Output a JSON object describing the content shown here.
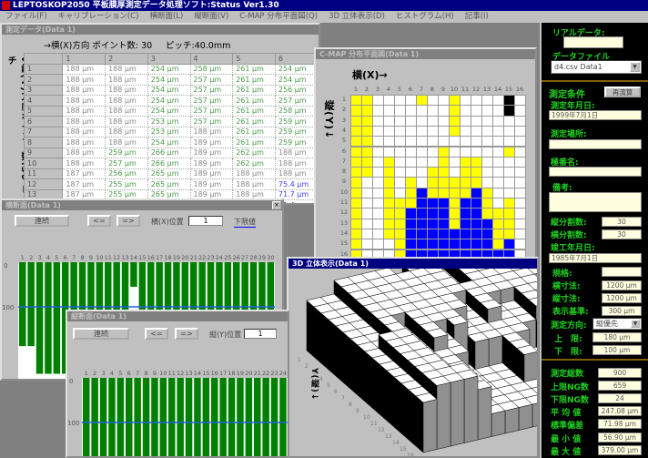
{
  "app": {
    "title": "LEPTOSKOP2050 平板膜厚測定データ処理ソフト:Status Ver1.30"
  },
  "menu": [
    "ファイル(F)",
    "キャリブレーション(C)",
    "横断面(L)",
    "縦断面(V)",
    "C-MAP 分布平面図(Q)",
    "3D 立体表示(D)",
    "ヒストグラム(H)",
    "記事(I)"
  ],
  "table_window": {
    "title": "測定データ(Data 1)",
    "header_text": "→横(X)方向 ポイント数:  30",
    "pitch_text": "ピッチ:40.0mm",
    "side_label": "↓縦(Y)方向ポイント数:30 ピッチ",
    "columns": [
      "1",
      "2",
      "3",
      "4",
      "5",
      "6"
    ],
    "rows": [
      [
        "1",
        "188 μm",
        "188 μm",
        "254 μm",
        "258 μm",
        "261 μm",
        "254 μm"
      ],
      [
        "2",
        "188 μm",
        "188 μm",
        "254 μm",
        "257 μm",
        "261 μm",
        "254 μm"
      ],
      [
        "3",
        "188 μm",
        "188 μm",
        "254 μm",
        "257 μm",
        "261 μm",
        "256 μm"
      ],
      [
        "4",
        "188 μm",
        "188 μm",
        "254 μm",
        "257 μm",
        "261 μm",
        "257 μm"
      ],
      [
        "5",
        "188 μm",
        "188 μm",
        "254 μm",
        "257 μm",
        "261 μm",
        "258 μm"
      ],
      [
        "6",
        "188 μm",
        "188 μm",
        "253 μm",
        "257 μm",
        "261 μm",
        "259 μm"
      ],
      [
        "7",
        "188 μm",
        "188 μm",
        "253 μm",
        "188 μm",
        "261 μm",
        "259 μm"
      ],
      [
        "8",
        "188 μm",
        "188 μm",
        "254 μm",
        "189 μm",
        "261 μm",
        "259 μm"
      ],
      [
        "9",
        "188 μm",
        "259 μm",
        "266 μm",
        "189 μm",
        "262 μm",
        "188 μm"
      ],
      [
        "10",
        "188 μm",
        "257 μm",
        "266 μm",
        "189 μm",
        "262 μm",
        "188 μm"
      ],
      [
        "11",
        "187 μm",
        "256 μm",
        "265 μm",
        "189 μm",
        "188 μm",
        "188 μm"
      ],
      [
        "12",
        "187 μm",
        "255 μm",
        "265 μm",
        "189 μm",
        "188 μm",
        "75.4 μm"
      ],
      [
        "13",
        "187 μm",
        "255 μm",
        "265 μm",
        "189 μm",
        "188 μm",
        "71.7 μm"
      ],
      [
        "14",
        "187 μm",
        "255 μm",
        "265 μm",
        "189 μm",
        "188 μm",
        "71.4 μm"
      ]
    ]
  },
  "cmap_window": {
    "title": "C-MAP 分布平面図(Data 1)",
    "x_label": "横(X)→",
    "y_label": "縦(Y)↓",
    "col_labels": [
      "1",
      "2",
      "3",
      "4",
      "5",
      "6",
      "7",
      "8",
      "9",
      "10",
      "11",
      "12",
      "13",
      "14",
      "15",
      "16"
    ],
    "row_labels": [
      "1",
      "2",
      "3",
      "4",
      "5",
      "6",
      "7",
      "8",
      "9",
      "10",
      "11",
      "12",
      "13",
      "14",
      "15",
      "16"
    ],
    "colors": {
      "W": "#ffffff",
      "Y": "#ffff00",
      "B": "#0000ff",
      "K": "#000000"
    },
    "grid": [
      "YYWWWWYWWYWWWWKW",
      "YYWWWWWWWYWWWWKW",
      "YYWWWWWWWYWWWWWW",
      "YYWWWWWWWYWWWWWW",
      "YYWWWWWWWWWWWWWW",
      "YYWWWWWWYWWWWWYW",
      "YYWYWWWWYWYYWWWW",
      "YYWYWWWYYWYYWWWW",
      "YWWYWYWYYYYYWWWW",
      "YWWYWYBYYYYBYWWW",
      "YWWYYYBBBYBBYWYW",
      "YWWYYBBBBYBBYYYW",
      "YWWYYBBBBYBBBYYW",
      "YWWYYBBBBBBBBYYW",
      "YWWWYBBBBBBBBYBW",
      "YWWWYBBBBBBBBBBW"
    ]
  },
  "view3d": {
    "title": "3D 立体表示(Data 1)",
    "y_label": "Y(縦)↓"
  },
  "chart1": {
    "title": "横断面(Data 1)",
    "buttons": {
      "continuous": "連続",
      "prev": "<=",
      "next": "=>"
    },
    "pos_label": "横(X)位置",
    "pos_value": "1",
    "lower_link": "下限値",
    "y_ticks": [
      "0",
      "100"
    ],
    "x_labels": [
      "1",
      "2",
      "3",
      "4",
      "5",
      "6",
      "7",
      "8",
      "9",
      "10",
      "11",
      "12",
      "13",
      "14",
      "15",
      "16",
      "17",
      "18",
      "19",
      "20",
      "21",
      "22",
      "23",
      "24",
      "25",
      "26",
      "27",
      "28",
      "29",
      "30"
    ],
    "values": [
      188,
      188,
      250,
      250,
      250,
      250,
      250,
      250,
      250,
      250,
      250,
      250,
      250,
      55,
      250,
      250,
      250,
      250,
      250,
      250,
      250,
      250,
      250,
      250,
      250,
      250,
      250,
      250,
      250,
      250
    ],
    "reference_line": 100,
    "bar_color": "#008000"
  },
  "chart2": {
    "title": "縦断面(Data 1)",
    "buttons": {
      "continuous": "連続",
      "prev": "<=",
      "next": "=>"
    },
    "pos_label": "縦(Y)位置",
    "pos_value": "1",
    "y_ticks": [
      "0",
      "100"
    ],
    "x_labels": [
      "1",
      "2",
      "3",
      "4",
      "5",
      "6",
      "7",
      "8",
      "9",
      "10",
      "11",
      "12",
      "13",
      "14",
      "15",
      "16",
      "17",
      "18",
      "19",
      "20",
      "21",
      "22",
      "23",
      "24"
    ],
    "values": [
      250,
      250,
      250,
      250,
      250,
      250,
      250,
      250,
      250,
      250,
      250,
      250,
      250,
      250,
      250,
      250,
      250,
      250,
      250,
      250,
      250,
      250,
      250,
      250
    ],
    "reference_line": 100,
    "bar_color": "#008000"
  },
  "panel": {
    "real_data_label": "リアルデータ:",
    "real_data_value": "",
    "data_file_label": "データファイル",
    "data_file_value": "d4.csv  Data1",
    "conditions_label": "測定条件",
    "recalc_button": "再演算",
    "date_label": "測定年月日:",
    "date_value": "1999年7月1日",
    "place_label": "測定場所:",
    "place_value": "",
    "name_label": "極番名:",
    "name_value": "",
    "note_label": "備考:",
    "note_value": "",
    "vdiv_label": "縦分割数:",
    "vdiv_value": "30",
    "hdiv_label": "横分割数:",
    "hdiv_value": "30",
    "built_label": "竣工年月日:",
    "built_value": "1985年7月1日",
    "spec_label": "規格:",
    "spec_value": "",
    "hsize_label": "横寸法:",
    "hsize_value": "1200 μm",
    "vsize_label": "縦寸法:",
    "vsize_value": "1200 μm",
    "base_label": "表示基準:",
    "base_value": "300 μm",
    "dir_label": "測定方向:",
    "dir_value": "縦優先",
    "upper_label": "上　限:",
    "upper_value": "180 μm",
    "lower_label": "下　限:",
    "lower_value": "100 μm",
    "total_label": "測定総数",
    "total_value": "900",
    "upper_ng_label": "上限NG数",
    "upper_ng_value": "659",
    "lower_ng_label": "下限NG数",
    "lower_ng_value": "24",
    "avg_label": "平 均 値",
    "avg_value": "247.08 μm",
    "std_label": "標準偏差",
    "std_value": "71.98 μm",
    "min_label": "最 小 値",
    "min_value": "56.90 μm",
    "max_label": "最 大 値",
    "max_value": "379.00 μm"
  }
}
